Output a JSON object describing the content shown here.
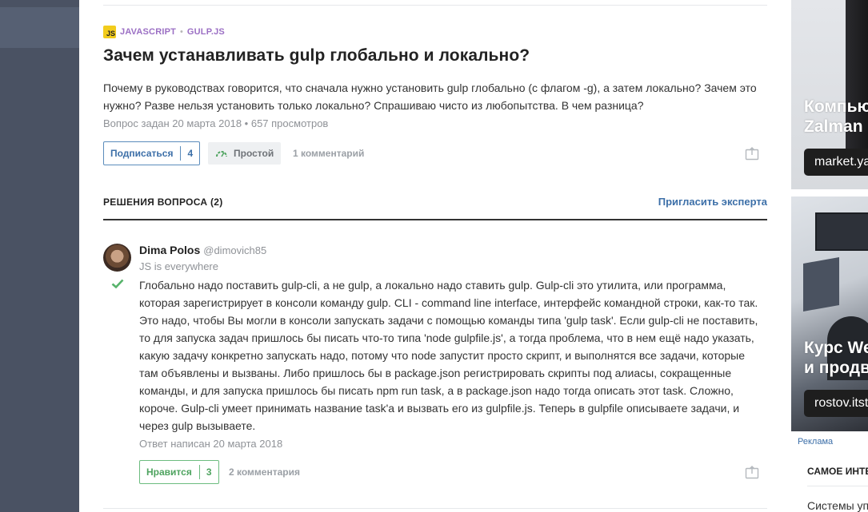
{
  "question": {
    "tags": [
      {
        "badge": "JS",
        "label": "JAVASCRIPT"
      },
      {
        "label": "GULP.JS"
      }
    ],
    "tag_separator": "•",
    "title": "Зачем устанавливать gulp глобально и локально?",
    "body_line1": "Почему в руководствах говорится, что сначала нужно установить gulp глобально (с флагом -g), а затем локально? Зачем это",
    "body_line2": "нужно? Разве нельзя установить только локально? Спрашиваю чисто из любопытства. В чем разница?",
    "meta": "Вопрос задан 20 марта 2018 • 657 просмотров",
    "subscribe_label": "Подписаться",
    "subscribe_count": "4",
    "difficulty": "Простой",
    "comments": "1 комментарий"
  },
  "solutions": {
    "heading": "РЕШЕНИЯ ВОПРОСА",
    "count": "(2)",
    "invite_label": "Пригласить эксперта"
  },
  "answer": {
    "author_name": "Dima Polos",
    "author_nick": "@dimovich85",
    "author_subtitle": "JS is everywhere",
    "lines": [
      "Глобально надо поставить gulp-cli, а не gulp, а локально надо ставить gulp. Gulp-cli это утилита, или программа,",
      "которая зарегистрирует в консоли команду gulp. CLI - command line interface, интерфейс командной строки, как-то так.",
      "Это надо, чтобы Вы могли в консоли запускать задачи с помощью команды типа 'gulp task'. Если gulp-cli не поставить,",
      "то для запуска задач пришлось бы писать что-то типа 'node gulpfile.js', а тогда проблема, что в нем ещё надо указать,",
      "какую задачу конкретно запускать надо, потому что node запустит просто скрипт, и выполнятся все задачи, которые",
      "там объявлены и вызваны. Либо пришлось бы в package.json регистрировать скрипты под алиасы, сокращенные",
      "команды, и для запуска пришлось бы писать npm run task, а в package.json надо тогда описать этот task. Сложно,",
      "короче. Gulp-cli умеет принимать название task'a и вызвать его из gulpfile.js. Теперь в gulpfile описываете задачи, и",
      "через gulp вызываете."
    ],
    "meta": "Ответ написан 20 марта 2018",
    "like_label": "Нравится",
    "like_count": "3",
    "comments": "2 комментария"
  },
  "sidebar": {
    "ad1_title_line1": "Компьютер",
    "ad1_title_line2": "Zalman",
    "ad1_button": "market.yandex",
    "ad2_title_line1": "Курс Web",
    "ad2_title_line2": "и продв",
    "ad2_button": "rostov.itstep",
    "ad_label": "Реклама",
    "section_heading": "САМОЕ ИНТЕРЕСНОЕ",
    "first_item": "Системы уп"
  }
}
